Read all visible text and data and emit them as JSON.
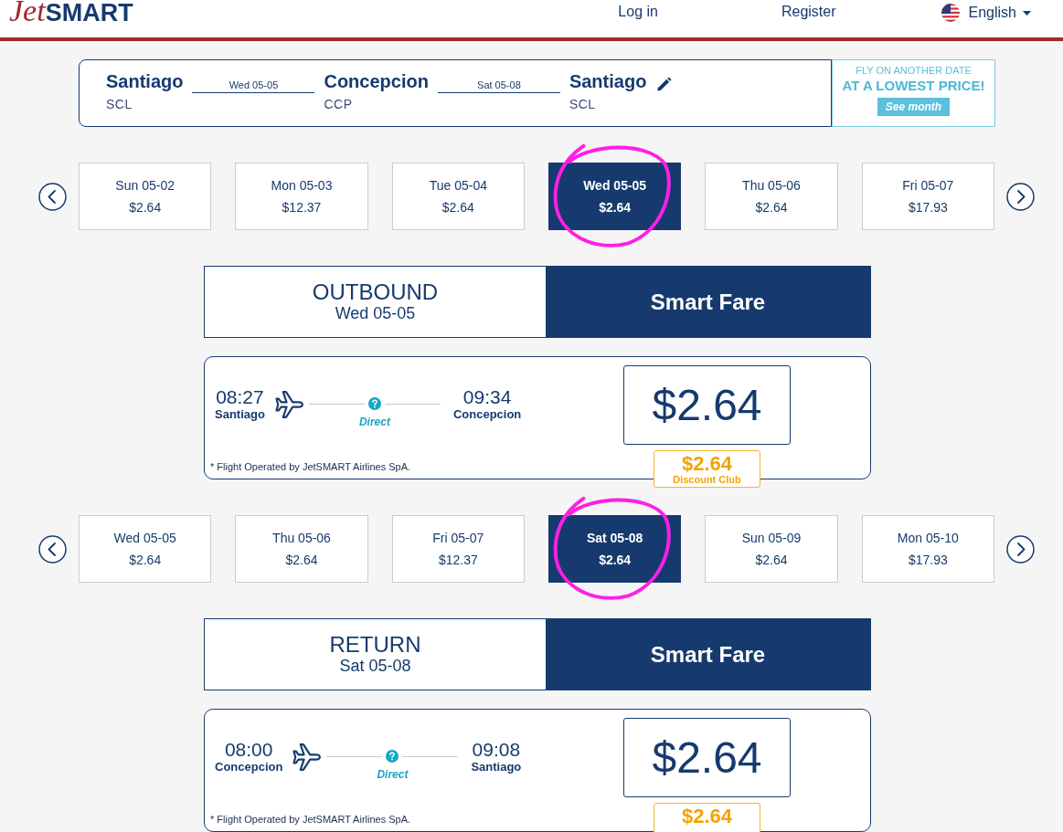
{
  "header": {
    "logo": {
      "script": "Jet",
      "wordmark": "SMART"
    },
    "nav": [
      {
        "label": "Log in"
      },
      {
        "label": "Register"
      }
    ],
    "language": {
      "label": "English"
    }
  },
  "route": {
    "legs": [
      {
        "city": "Santiago",
        "code": "SCL"
      },
      {
        "city": "Concepcion",
        "code": "CCP"
      },
      {
        "city": "Santiago",
        "code": "SCL"
      }
    ],
    "dates": [
      "Wed 05-05",
      "Sat 05-08"
    ],
    "promo": {
      "line_1": "FLY ON ANOTHER DATE",
      "line_2": "AT A LOWEST PRICE!",
      "button": "See month"
    }
  },
  "journeys": [
    {
      "dates": [
        {
          "day": "Sun 05-02",
          "price": "$2.64",
          "selected": false,
          "circled": false
        },
        {
          "day": "Mon 05-03",
          "price": "$12.37",
          "selected": false,
          "circled": false
        },
        {
          "day": "Tue 05-04",
          "price": "$2.64",
          "selected": false,
          "circled": false
        },
        {
          "day": "Wed 05-05",
          "price": "$2.64",
          "selected": true,
          "circled": true
        },
        {
          "day": "Thu 05-06",
          "price": "$2.64",
          "selected": false,
          "circled": false
        },
        {
          "day": "Fri 05-07",
          "price": "$17.93",
          "selected": false,
          "circled": false
        }
      ],
      "header": {
        "direction": "OUTBOUND",
        "date": "Wed 05-05",
        "fare": "Smart Fare"
      },
      "flight": {
        "departure_time": "08:27",
        "origin": "Santiago",
        "stops": "Direct",
        "arrival_time": "09:34",
        "destination": "Concepcion",
        "price": "$2.64",
        "discount": {
          "price": "$2.64",
          "label": "Discount Club"
        },
        "operator_note": "* Flight Operated by JetSMART Airlines SpA."
      }
    },
    {
      "dates": [
        {
          "day": "Wed 05-05",
          "price": "$2.64",
          "selected": false,
          "circled": false
        },
        {
          "day": "Thu 05-06",
          "price": "$2.64",
          "selected": false,
          "circled": false
        },
        {
          "day": "Fri 05-07",
          "price": "$12.37",
          "selected": false,
          "circled": false
        },
        {
          "day": "Sat 05-08",
          "price": "$2.64",
          "selected": true,
          "circled": true
        },
        {
          "day": "Sun 05-09",
          "price": "$2.64",
          "selected": false,
          "circled": false
        },
        {
          "day": "Mon 05-10",
          "price": "$17.93",
          "selected": false,
          "circled": false
        }
      ],
      "header": {
        "direction": "RETURN",
        "date": "Sat 05-08",
        "fare": "Smart Fare"
      },
      "flight": {
        "departure_time": "08:00",
        "origin": "Concepcion",
        "stops": "Direct",
        "arrival_time": "09:08",
        "destination": "Santiago",
        "price": "$2.64",
        "discount": {
          "price": "$2.64"
        },
        "operator_note": "* Flight Operated by JetSMART Airlines SpA."
      }
    }
  ]
}
